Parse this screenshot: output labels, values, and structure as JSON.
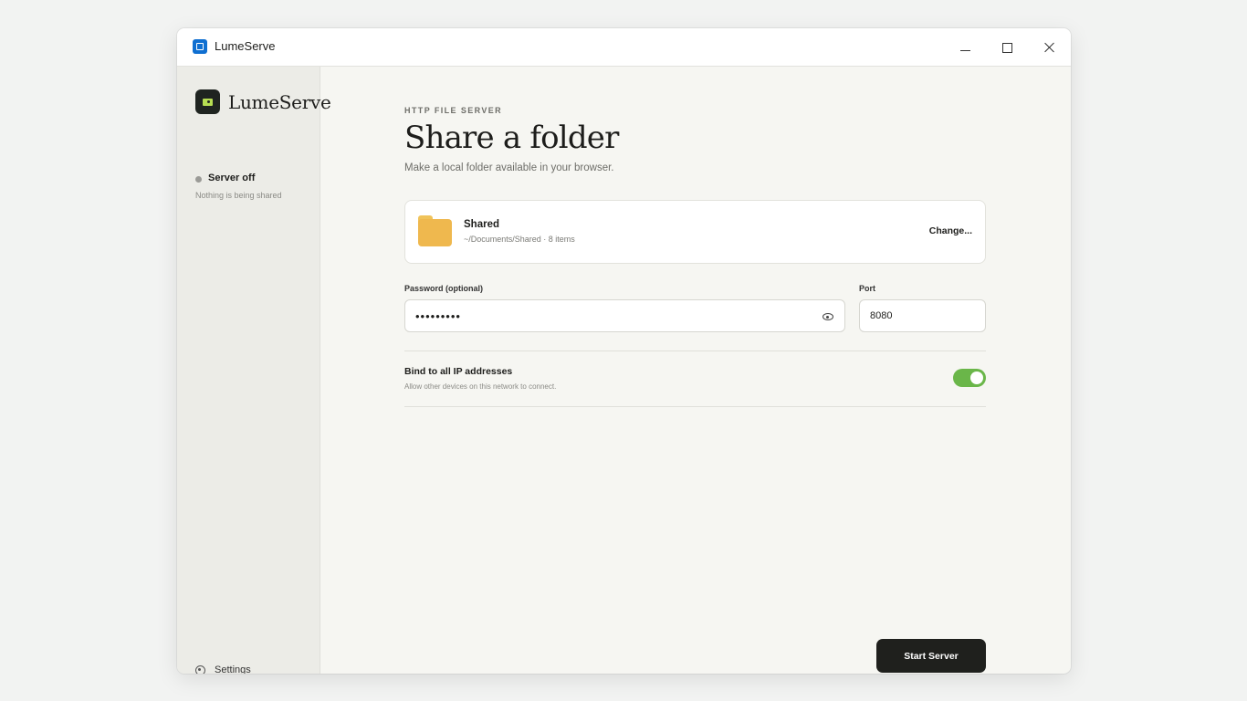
{
  "window": {
    "title": "LumeServe"
  },
  "sidebar": {
    "brand_name": "LumeServe",
    "status_title": "Server off",
    "status_subtitle": "Nothing is being shared",
    "settings_label": "Settings"
  },
  "main": {
    "eyebrow": "HTTP FILE SERVER",
    "headline": "Share a folder",
    "subtitle": "Make a local folder available in your browser.",
    "folder": {
      "name": "Shared",
      "path": "~/Documents/Shared · 8 items",
      "change_label": "Change..."
    },
    "password": {
      "label": "Password (optional)",
      "value": "•••••••••"
    },
    "port": {
      "label": "Port",
      "value": "8080"
    },
    "bind": {
      "title": "Bind to all IP addresses",
      "subtitle": "Allow other devices on this network to connect.",
      "enabled": true
    },
    "start_label": "Start Server"
  },
  "colors": {
    "accent_toggle": "#6ab649",
    "primary_button": "#1f201d",
    "brand_accent": "#b6dd52",
    "folder": "#efb84e"
  }
}
